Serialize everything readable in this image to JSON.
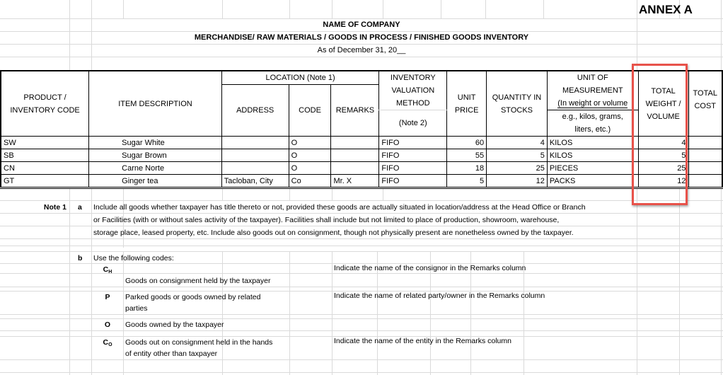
{
  "annex": "ANNEX A",
  "header": {
    "company": "NAME OF COMPANY",
    "report_title": "MERCHANDISE/ RAW MATERIALS / GOODS IN PROCESS / FINISHED GOODS INVENTORY",
    "as_of": "As of December 31, 20__"
  },
  "table": {
    "headers": {
      "product_code": "PRODUCT / INVENTORY CODE",
      "product_code_l1": "PRODUCT /",
      "product_code_l2": "INVENTORY CODE",
      "item_description": "ITEM DESCRIPTION",
      "location": "LOCATION (Note 1)",
      "address": "ADDRESS",
      "code": "CODE",
      "remarks": "REMARKS",
      "valuation_l1": "INVENTORY",
      "valuation_l2": "VALUATION",
      "valuation_l3": "METHOD",
      "valuation_note": "(Note 2)",
      "unit_price_l1": "UNIT",
      "unit_price_l2": "PRICE",
      "quantity_l1": "QUANTITY IN",
      "quantity_l2": "STOCKS",
      "uom_l1": "UNIT OF",
      "uom_l2": "MEASUREMENT",
      "uom_l3": "(In weight or volume",
      "uom_l4": "e.g., kilos, grams,",
      "uom_l5": "liters, etc.)",
      "total_weight_l1": "TOTAL",
      "total_weight_l2": "WEIGHT /",
      "total_weight_l3": "VOLUME",
      "total_cost_l1": "TOTAL",
      "total_cost_l2": "COST"
    },
    "rows": [
      {
        "code": "SW",
        "description": "Sugar White",
        "address": "",
        "loc_code": "O",
        "remarks": "",
        "method": "FIFO",
        "unit_price": "60",
        "quantity": "4",
        "uom": "KILOS",
        "total_weight": "4",
        "total_cost": ""
      },
      {
        "code": "SB",
        "description": "Sugar Brown",
        "address": "",
        "loc_code": "O",
        "remarks": "",
        "method": "FIFO",
        "unit_price": "55",
        "quantity": "5",
        "uom": "KILOS",
        "total_weight": "5",
        "total_cost": ""
      },
      {
        "code": "CN",
        "description": "Carne Norte",
        "address": "",
        "loc_code": "O",
        "remarks": "",
        "method": "FIFO",
        "unit_price": "18",
        "quantity": "25",
        "uom": "PIECES",
        "total_weight": "25",
        "total_cost": ""
      },
      {
        "code": "GT",
        "description": "Ginger tea",
        "address": "Tacloban, City",
        "loc_code": "Co",
        "remarks": "Mr. X",
        "method": "FIFO",
        "unit_price": "5",
        "quantity": "12",
        "uom": "PACKS",
        "total_weight": "12",
        "total_cost": ""
      }
    ]
  },
  "highlight": {
    "color": "#e8524a",
    "target": "TOTAL WEIGHT / VOLUME"
  },
  "notes": {
    "note1_label": "Note 1",
    "a_label": "a",
    "a_lines": [
      "Include all goods whether taxpayer has title thereto or not, provided these goods are actually situated in location/address at the Head Office or Branch",
      "or Facilities (with or without sales activity of the taxpayer).  Facilities shall include but not limited to place of production, showroom, warehouse,",
      "storage place, leased property, etc.  Include also goods out on consignment, though not physically present are nonetheless owned by the taxpayer."
    ],
    "b_label": "b",
    "b_intro": "Use the following codes:",
    "codes": [
      {
        "code_main": "C",
        "code_sub": "H",
        "desc_l1": "Goods on consignment held by the taxpayer",
        "desc_l2": "",
        "instruction": "Indicate the name of the consignor in the Remarks column"
      },
      {
        "code_main": "P",
        "code_sub": "",
        "desc_l1": "Parked goods or goods owned by related",
        "desc_l2": "parties",
        "instruction": "Indicate the name of related party/owner in the Remarks column"
      },
      {
        "code_main": "O",
        "code_sub": "",
        "desc_l1": "Goods owned by the taxpayer",
        "desc_l2": "",
        "instruction": ""
      },
      {
        "code_main": "C",
        "code_sub": "O",
        "desc_l1": "Goods out on consignment held in the hands",
        "desc_l2": "of entity other than taxpayer",
        "instruction": "Indicate the name of the entity in the Remarks column"
      }
    ]
  }
}
